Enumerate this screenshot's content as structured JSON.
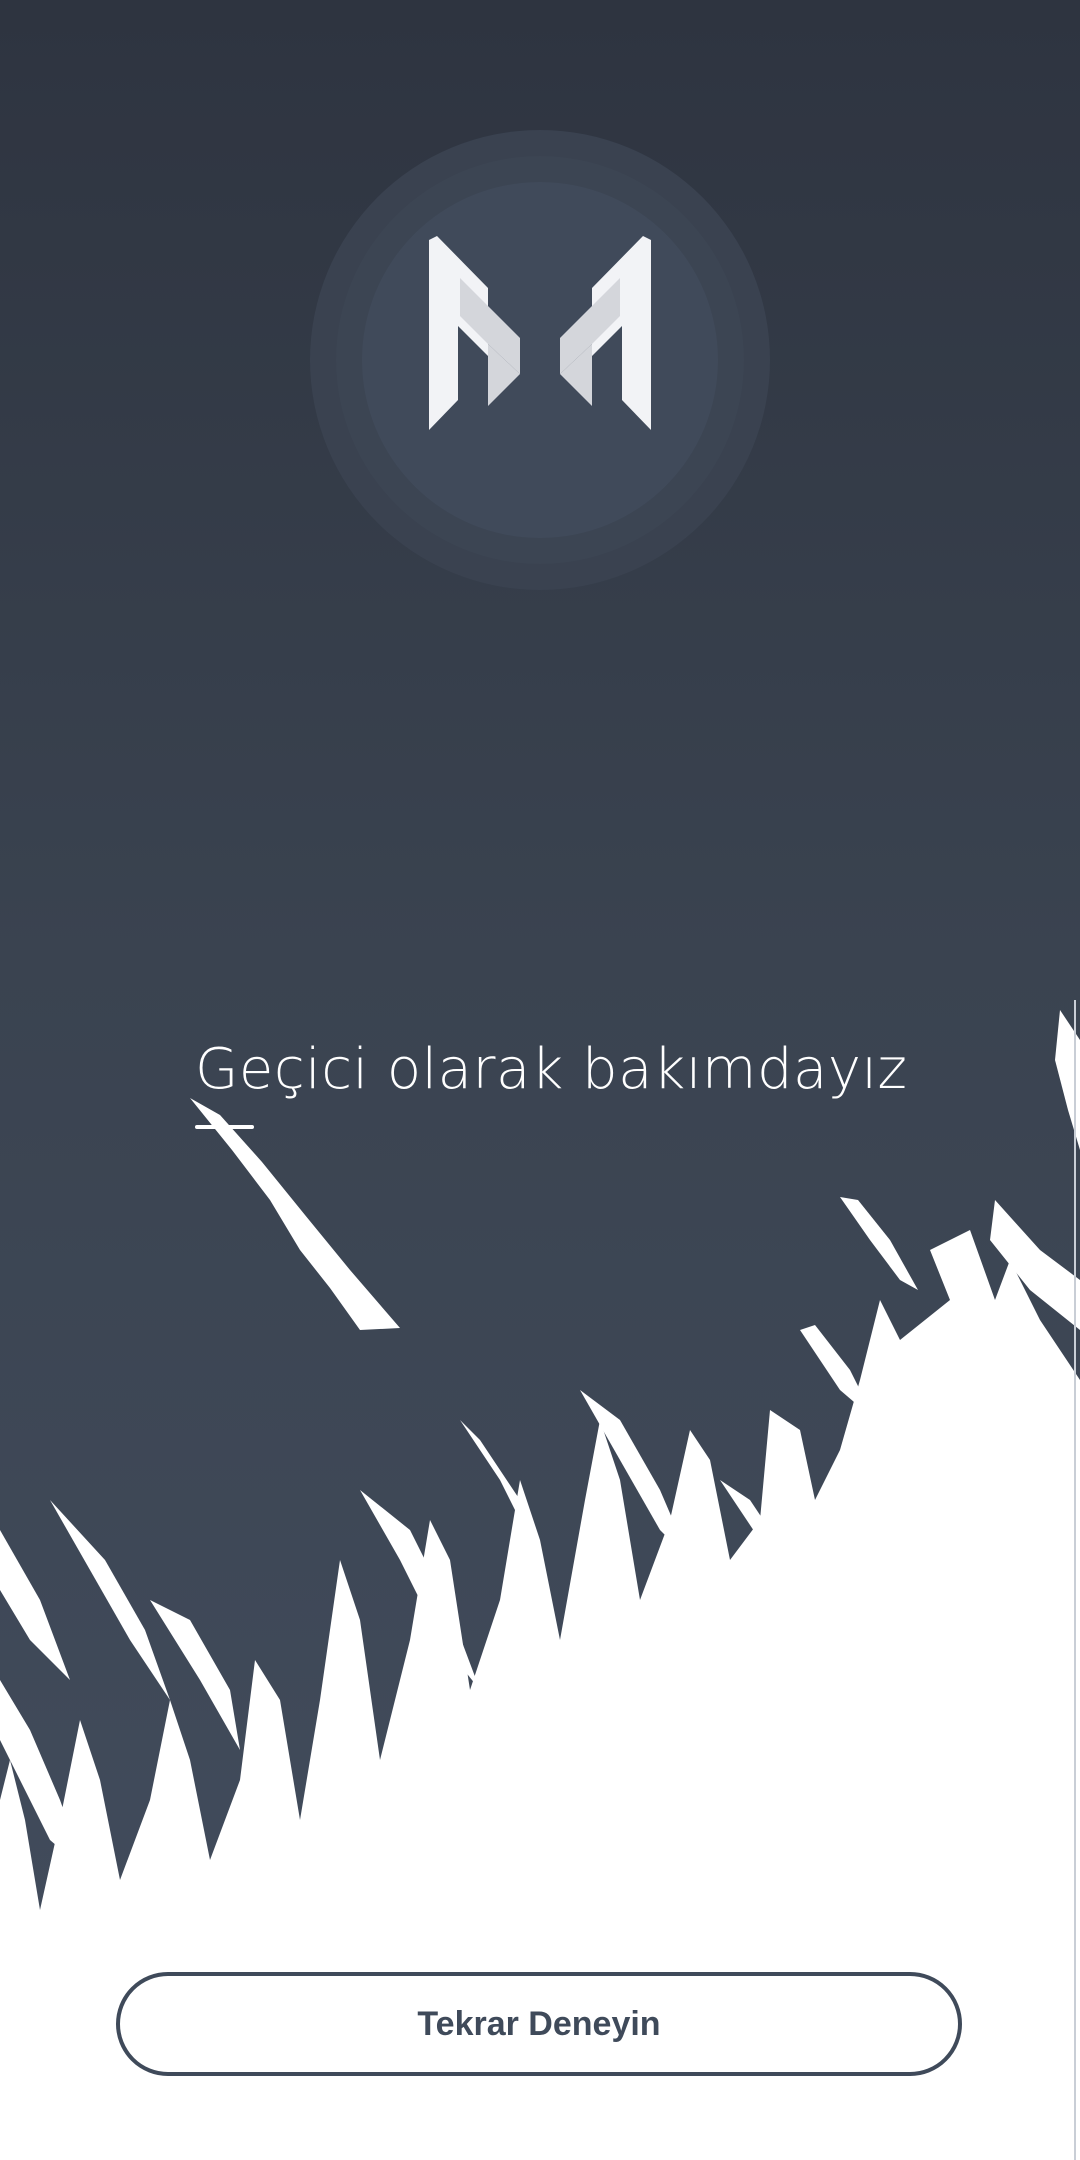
{
  "maintenance": {
    "title": "Geçici olarak bakımdayız",
    "retry_label": "Tekrar Deneyin"
  },
  "logo": {
    "icon": "m-logo-icon"
  },
  "colors": {
    "background_top": "#2e3440",
    "background_mid": "#3b4452",
    "background_bottom": "#414b5b",
    "button_border": "#3f4a5a",
    "button_text": "#3f4a5a",
    "logo_main": "#f2f3f6",
    "logo_shade": "#d4d6db"
  }
}
